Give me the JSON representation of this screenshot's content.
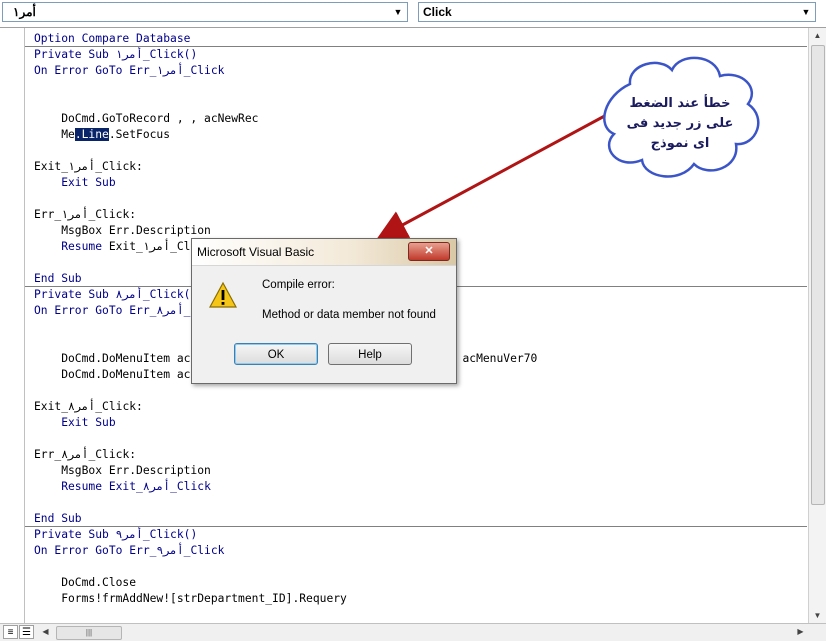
{
  "toolbar": {
    "object_combo_value": "أمر١",
    "procedure_combo_value": "Click"
  },
  "code": {
    "lines": [
      [
        {
          "t": "Option Compare Database",
          "kw": true
        }
      ],
      [
        {
          "t": "Private Sub ",
          "kw": true
        },
        {
          "t": "أمر١_Click()",
          "kw": true
        }
      ],
      [
        {
          "t": "On Error GoTo ",
          "kw": true
        },
        {
          "t": "Err_أمر١_Click",
          "kw": true
        }
      ],
      [],
      [],
      [
        {
          "t": "    DoCmd.GoToRecord , , acNewRec"
        }
      ],
      [
        {
          "t": "    Me"
        },
        {
          "t": ".Line",
          "hl": true
        },
        {
          "t": ".SetFocus"
        }
      ],
      [],
      [
        {
          "t": "Exit_أمر١_Click:"
        }
      ],
      [
        {
          "t": "    Exit Sub",
          "kw": true
        }
      ],
      [],
      [
        {
          "t": "Err_أمر١_Click:"
        }
      ],
      [
        {
          "t": "    MsgBox Err.Description"
        }
      ],
      [
        {
          "t": "    Resume ",
          "kw": true
        },
        {
          "t": "Exit_أمر١_Click"
        }
      ],
      [],
      [
        {
          "t": "End Sub",
          "kw": true
        }
      ],
      [
        {
          "t": "Private Sub ",
          "kw": true
        },
        {
          "t": "أمر٨_Click()",
          "kw": true
        }
      ],
      [
        {
          "t": "On Error GoTo ",
          "kw": true
        },
        {
          "t": "Err_أمر٨_Click",
          "kw": true
        }
      ],
      [],
      [],
      [
        {
          "t": "    DoCmd.DoMenuItem acFormBar, acRecordsMenu, acSaveRecord, , acMenuVer70"
        }
      ],
      [
        {
          "t": "    DoCmd.DoMenuItem acFormBar, acEditMenu, 10, , acMenuVer70"
        }
      ],
      [],
      [
        {
          "t": "Exit_أمر٨_Click:"
        }
      ],
      [
        {
          "t": "    Exit Sub",
          "kw": true
        }
      ],
      [],
      [
        {
          "t": "Err_أمر٨_Click:"
        }
      ],
      [
        {
          "t": "    MsgBox Err.Description"
        }
      ],
      [
        {
          "t": "    Resume ",
          "kw": true
        },
        {
          "t": "Exit_أمر٨_Click",
          "kw": true
        }
      ],
      [],
      [
        {
          "t": "End Sub",
          "kw": true
        }
      ],
      [
        {
          "t": "Private Sub ",
          "kw": true
        },
        {
          "t": "أمر٩_Click()",
          "kw": true
        }
      ],
      [
        {
          "t": "On Error GoTo ",
          "kw": true
        },
        {
          "t": "Err_أمر٩_Click",
          "kw": true
        }
      ],
      [],
      [
        {
          "t": "    DoCmd.Close"
        }
      ],
      [
        {
          "t": "    Forms!frmAddNew![strDepartment_ID].Requery"
        }
      ]
    ]
  },
  "dialog": {
    "title": "Microsoft Visual Basic",
    "close_label": "✕",
    "line1": "Compile error:",
    "line2": "Method or data member not found",
    "ok_label": "OK",
    "help_label": "Help"
  },
  "callout": {
    "lines": [
      "خطأ عند الضغط",
      "على زر جديد فى",
      "اى نموذج"
    ]
  },
  "colors": {
    "keyword": "#00008b",
    "selection": "#0a246a",
    "arrow": "#b01414",
    "cloud_fill": "#ffffff",
    "cloud_stroke": "#3b55c8"
  },
  "icons": [
    "chevron-down-icon",
    "warning-icon",
    "close-icon",
    "procedure-view-icon",
    "full-module-view-icon",
    "scroll-arrow-icon"
  ]
}
